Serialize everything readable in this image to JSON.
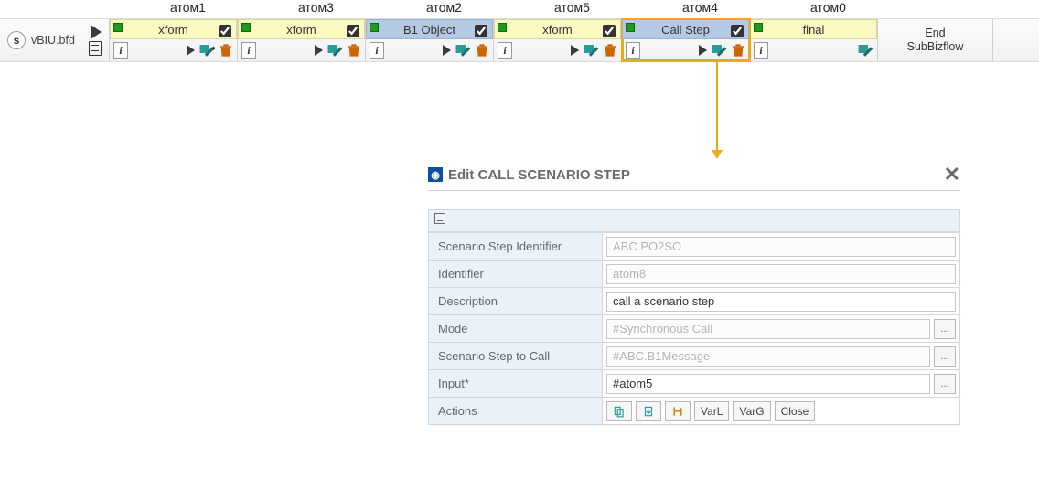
{
  "labels": {
    "atom1": "атом1",
    "atom3": "атом3",
    "atom2": "атом2",
    "atom5": "атом5",
    "atom4": "атом4",
    "atom0": "атом0"
  },
  "start": {
    "badge": "s",
    "filename": "vBIU.bfd"
  },
  "atoms": [
    {
      "id": "a1",
      "style": "yellow",
      "label": "xform",
      "checked": true,
      "hasTrash": true
    },
    {
      "id": "a3",
      "style": "yellow",
      "label": "xform",
      "checked": true,
      "hasTrash": true
    },
    {
      "id": "a2",
      "style": "blue",
      "label": "B1 Object",
      "checked": true,
      "hasTrash": true
    },
    {
      "id": "a5",
      "style": "yellow",
      "label": "xform",
      "checked": true,
      "hasTrash": true
    },
    {
      "id": "a4",
      "style": "blue",
      "label": "Call Step",
      "checked": true,
      "hasTrash": true,
      "highlighted": true
    },
    {
      "id": "a0",
      "style": "yellow",
      "label": "final",
      "checked": false,
      "hasTrash": false
    }
  ],
  "end": {
    "line1": "End",
    "line2": "SubBizflow"
  },
  "dialog": {
    "title": "Edit CALL SCENARIO STEP",
    "rows": {
      "scenario_step_identifier": {
        "label": "Scenario Step Identifier",
        "value": "ABC.PO2SO",
        "readonly": true
      },
      "identifier": {
        "label": "Identifier",
        "value": "atom8",
        "readonly": true
      },
      "description": {
        "label": "Description",
        "value": "call a scenario step",
        "readonly": false
      },
      "mode": {
        "label": "Mode",
        "value": "#Synchronous Call",
        "readonly": true,
        "picker": true
      },
      "step_to_call": {
        "label": "Scenario Step to Call",
        "value": "#ABC.B1Message",
        "readonly": true,
        "picker": true
      },
      "input": {
        "label": "Input*",
        "value": "#atom5",
        "readonly": false,
        "picker": true
      }
    },
    "actions": {
      "label": "Actions",
      "varl": "VarL",
      "varg": "VarG",
      "close": "Close"
    }
  }
}
